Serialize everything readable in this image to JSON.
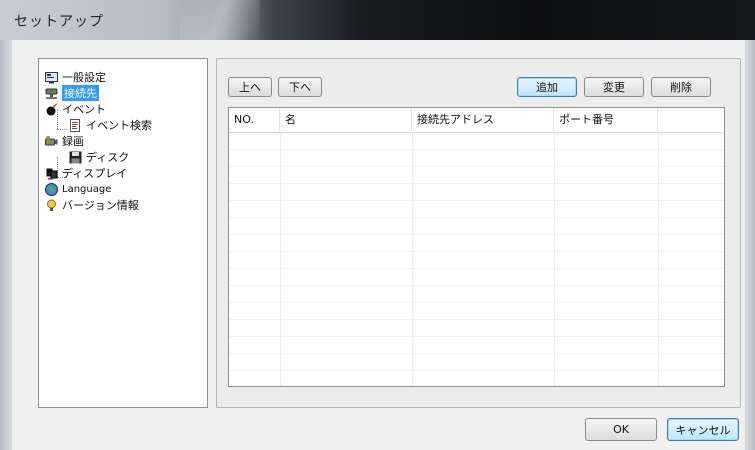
{
  "window": {
    "title": "セットアップ"
  },
  "tree": {
    "items": [
      {
        "label": "一般設定",
        "icon": "monitor-settings-icon",
        "level": 0,
        "selected": false
      },
      {
        "label": "接続先",
        "icon": "network-icon",
        "level": 0,
        "selected": true
      },
      {
        "label": "イベント",
        "icon": "bomb-icon",
        "level": 0,
        "selected": false
      },
      {
        "label": "イベント検索",
        "icon": "document-search-icon",
        "level": 1,
        "selected": false
      },
      {
        "label": "録画",
        "icon": "camera-icon",
        "level": 0,
        "selected": false
      },
      {
        "label": "ディスク",
        "icon": "floppy-disk-icon",
        "level": 1,
        "selected": false
      },
      {
        "label": "ディスプレイ",
        "icon": "display-icon",
        "level": 0,
        "selected": false
      },
      {
        "label": "Language",
        "icon": "globe-icon",
        "level": 0,
        "selected": false
      },
      {
        "label": "バージョン情報",
        "icon": "info-bulb-icon",
        "level": 0,
        "selected": false
      }
    ]
  },
  "toolbar": {
    "up_label": "上へ",
    "down_label": "下へ",
    "add_label": "追加",
    "change_label": "変更",
    "delete_label": "削除"
  },
  "table": {
    "columns": [
      "NO.",
      "名",
      "接続先アドレス",
      "ポート番号",
      ""
    ],
    "rows": []
  },
  "footer": {
    "ok_label": "OK",
    "cancel_label": "キャンセル"
  },
  "colors": {
    "selection": "#3399ff",
    "default_button_border": "#3c7fb1"
  }
}
